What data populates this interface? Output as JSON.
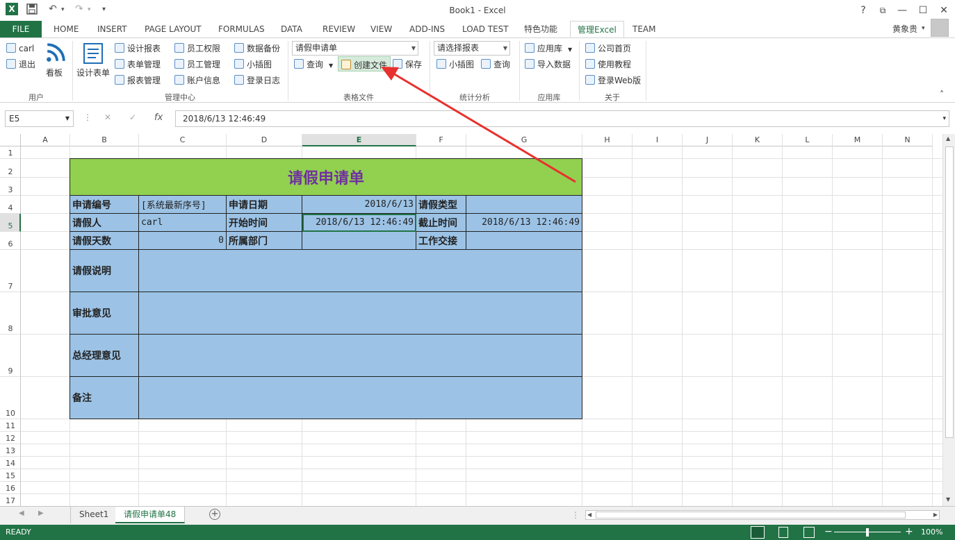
{
  "window": {
    "title": "Book1 - Excel",
    "help_label": "?",
    "restore_label": "⧉",
    "minimize_label": "—",
    "maximize_label": "☐",
    "close_label": "✕"
  },
  "quick_access": {
    "excel_icon_label": "X",
    "save_icon_label": "💾",
    "undo_label": "↶",
    "redo_label": "↷",
    "customize_label": "▾"
  },
  "tabs": {
    "file": "FILE",
    "items": [
      "HOME",
      "INSERT",
      "PAGE LAYOUT",
      "FORMULAS",
      "DATA",
      "REVIEW",
      "VIEW",
      "ADD-INS",
      "LOAD TEST",
      "特色功能",
      "管理Excel",
      "TEAM"
    ],
    "active_index": 10,
    "user_name": "黄象贵",
    "user_dropdown": "▾"
  },
  "ribbon": {
    "user_group": {
      "label": "用户",
      "items": [
        "carl",
        "退出"
      ],
      "big_button": "看板"
    },
    "manage_group": {
      "label": "管理中心",
      "big_button": "设计表单",
      "col1": [
        "设计报表",
        "表单管理",
        "报表管理"
      ],
      "col2": [
        "员工权限",
        "员工管理",
        "账户信息"
      ],
      "col3": [
        "数据备份",
        "小插图",
        "登录日志"
      ]
    },
    "table_file_group": {
      "label": "表格文件",
      "combo_value": "请假申请单",
      "query_label": "查询",
      "create_file_label": "创建文件",
      "save_label": "保存"
    },
    "stats_group": {
      "label": "统计分析",
      "combo_value": "请选择报表",
      "buttons": [
        "小插图",
        "查询"
      ]
    },
    "applib_group": {
      "label": "应用库",
      "buttons": [
        "应用库",
        "导入数据"
      ]
    },
    "about_group": {
      "label": "关于",
      "buttons": [
        "公司首页",
        "使用教程",
        "登录Web版"
      ]
    },
    "collapse_label": "˄"
  },
  "formula_bar": {
    "name_box": "E5",
    "cancel_label": "✕",
    "enter_label": "✓",
    "fx_label": "fx",
    "content": "2018/6/13  12:46:49"
  },
  "grid": {
    "columns": [
      "A",
      "B",
      "C",
      "D",
      "E",
      "F",
      "G",
      "H",
      "I",
      "J",
      "K",
      "L",
      "M",
      "N"
    ],
    "rows": [
      "1",
      "2",
      "3",
      "4",
      "5",
      "6",
      "7",
      "8",
      "9",
      "10",
      "11",
      "12",
      "13",
      "14",
      "15",
      "16",
      "17"
    ],
    "selected_column": "E",
    "selected_row": "5"
  },
  "form": {
    "title": "请假申请单",
    "row4": {
      "b": "申请编号",
      "c": "[系统最新序号]",
      "d": "申请日期",
      "e": "2018/6/13",
      "f": "请假类型",
      "g": ""
    },
    "row5": {
      "b": "请假人",
      "c": "carl",
      "d": "开始时间",
      "e": "2018/6/13 12:46:49",
      "f": "截止时间",
      "g": "2018/6/13 12:46:49"
    },
    "row6": {
      "b": "请假天数",
      "c": "0",
      "d": "所属部门",
      "e": "",
      "f": "工作交接",
      "g": ""
    },
    "row7": {
      "b": "请假说明"
    },
    "row8": {
      "b": "审批意见"
    },
    "row9": {
      "b": "总经理意见"
    },
    "row10": {
      "b": "备注"
    }
  },
  "sheets": {
    "items": [
      "Sheet1",
      "请假申请单48"
    ],
    "active_index": 1,
    "add_label": "+"
  },
  "status": {
    "mode": "READY",
    "zoom": "100%",
    "zoom_minus": "−",
    "zoom_plus": "+"
  },
  "annotation": {
    "arrow_color": "#e8312f"
  },
  "colors": {
    "excel_green": "#217346",
    "form_blue": "#9cc3e6",
    "title_green": "#92d050",
    "title_text": "#7030a0"
  }
}
